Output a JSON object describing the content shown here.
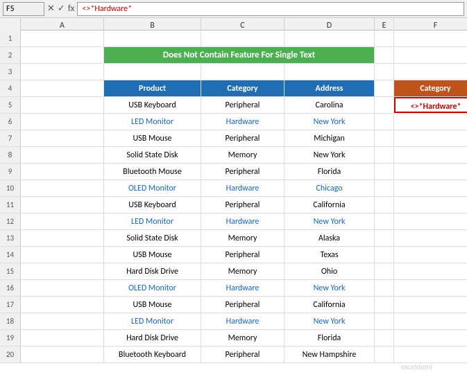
{
  "formula_bar": {
    "cell_ref": "F5",
    "formula": "<>*Hardware*",
    "cancel_label": "✕",
    "confirm_label": "✓",
    "fx_label": "fx"
  },
  "title": "Does Not Contain Feature For Single Text",
  "columns": {
    "a": "A",
    "b": "B",
    "c": "C",
    "d": "D",
    "e": "E",
    "f": "F"
  },
  "headers": {
    "product": "Product",
    "category": "Category",
    "address": "Address",
    "side_category": "Category"
  },
  "rows": [
    {
      "num": 1,
      "a": "",
      "b": "",
      "c": "",
      "d": "",
      "f": ""
    },
    {
      "num": 2,
      "a": "",
      "b": "Does Not Contain Feature For Single Text",
      "c": "",
      "d": "",
      "f": ""
    },
    {
      "num": 3,
      "a": "",
      "b": "",
      "c": "",
      "d": "",
      "f": ""
    },
    {
      "num": 4,
      "a": "",
      "b": "Product",
      "c": "Category",
      "d": "Address",
      "f": "Category"
    },
    {
      "num": 5,
      "a": "",
      "b": "USB Keyboard",
      "c": "Peripheral",
      "d": "Carolina",
      "f": "<>*Hardware*"
    },
    {
      "num": 6,
      "a": "",
      "b": "LED Monitor",
      "c": "Hardware",
      "d": "New York",
      "f": ""
    },
    {
      "num": 7,
      "a": "",
      "b": "USB Mouse",
      "c": "Peripheral",
      "d": "Michigan",
      "f": ""
    },
    {
      "num": 8,
      "a": "",
      "b": "Solid State Disk",
      "c": "Memory",
      "d": "New York",
      "f": ""
    },
    {
      "num": 9,
      "a": "",
      "b": "Bluetooth Mouse",
      "c": "Peripheral",
      "d": "Florida",
      "f": ""
    },
    {
      "num": 10,
      "a": "",
      "b": "OLED Monitor",
      "c": "Hardware",
      "d": "Chicago",
      "f": ""
    },
    {
      "num": 11,
      "a": "",
      "b": "USB Keyboard",
      "c": "Peripheral",
      "d": "California",
      "f": ""
    },
    {
      "num": 12,
      "a": "",
      "b": "LED Monitor",
      "c": "Hardware",
      "d": "New York",
      "f": ""
    },
    {
      "num": 13,
      "a": "",
      "b": "Solid State Disk",
      "c": "Memory",
      "d": "Alaska",
      "f": ""
    },
    {
      "num": 14,
      "a": "",
      "b": "USB Mouse",
      "c": "Peripheral",
      "d": "Texas",
      "f": ""
    },
    {
      "num": 15,
      "a": "",
      "b": "Hard Disk Drive",
      "c": "Memory",
      "d": "Ohio",
      "f": ""
    },
    {
      "num": 16,
      "a": "",
      "b": "OLED Monitor",
      "c": "Hardware",
      "d": "New York",
      "f": ""
    },
    {
      "num": 17,
      "a": "",
      "b": "USB Mouse",
      "c": "Peripheral",
      "d": "California",
      "f": ""
    },
    {
      "num": 18,
      "a": "",
      "b": "LED Monitor",
      "c": "Hardware",
      "d": "New York",
      "f": ""
    },
    {
      "num": 19,
      "a": "",
      "b": "Hard Disk Drive",
      "c": "Memory",
      "d": "Florida",
      "f": ""
    },
    {
      "num": 20,
      "a": "",
      "b": "Bluetooth Keyboard",
      "c": "Peripheral",
      "d": "New Hampshire",
      "f": ""
    }
  ],
  "colors": {
    "header_blue": "#1f6eb5",
    "title_green": "#4CAF50",
    "side_orange": "#c0521c",
    "selected_red": "#c00",
    "hardware_blue": "#1f6eb5"
  }
}
